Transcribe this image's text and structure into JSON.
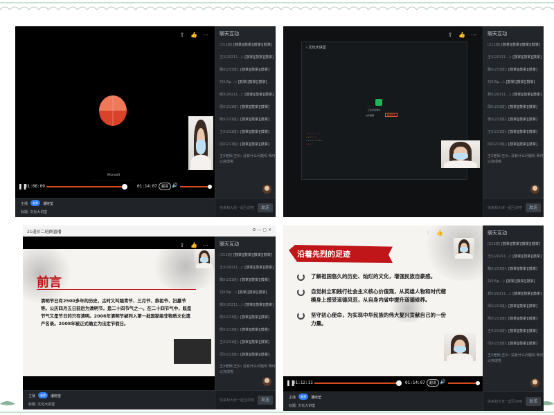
{
  "chat": {
    "title": "聊天互动",
    "placeholder": "快来和大家一起互动吧",
    "send_label": "发送",
    "messages": [
      {
        "who": "(211班)",
        "msg": "[鼓掌][鼓掌][鼓掌][鼓掌]"
      },
      {
        "who": "王X(20211...):",
        "msg": "[鼓掌][鼓掌][鼓掌]"
      },
      {
        "who": "魏X(231班):",
        "msg": "[鼓掌][鼓掌][鼓掌]"
      },
      {
        "who": "刘X(Sp...):",
        "msg": "[鼓掌][鼓掌][鼓掌]"
      },
      {
        "who": "郝X(20211...):",
        "msg": "[鼓掌][鼓掌][鼓掌]"
      },
      {
        "who": "周X(211班):",
        "msg": "[鼓掌][鼓掌][鼓掌]"
      },
      {
        "who": "杨X(211班):",
        "msg": "[鼓掌][鼓掌][鼓掌]"
      },
      {
        "who": "王X(211班):",
        "msg": "[鼓掌][鼓掌][鼓掌]"
      },
      {
        "who": "闫X(211班):",
        "msg": "[鼓掌][鼓掌][鼓掌]"
      }
    ],
    "last_message": "王X老师(王X):  没有什么问题吗 辉可以完成啦"
  },
  "info": {
    "host_label": "主播",
    "host_badge": "老师",
    "host_name": "潘晓莹",
    "title_label": "标题",
    "title_value": "文化大讲堂"
  },
  "panel1": {
    "time_current": "01:06:09",
    "time_total": "01:14:07",
    "quality": "超清",
    "progress": 0.88,
    "caption": "Microsoft"
  },
  "panel2": {
    "window_title": "文化大讲堂",
    "loading_text": "正在加载课件...",
    "share_label": "共享屏幕",
    "stop_label": "结束共享"
  },
  "panel3": {
    "window_title": "21道价二班群直播",
    "slide_heading": "前言",
    "slide_body": "清明节已有2500多年的历史，古时又叫踏青节、三月节、祭祖节、扫墓节等。公历四月五日前后为清明节，是二十四节气之一。在二十四节气中，既是节气又是节日的只有清明。2006年清明节被列入第一批国家级非物质文化遗产名录。2008年被正式确立为法定节假日。"
  },
  "panel4": {
    "time_current": "01:12:11",
    "time_total": "01:14:07",
    "quality": "超清",
    "progress": 0.97,
    "slide_title": "沿着先烈的足迹",
    "bullets": [
      "了解祖国悠久的历史、灿烂的文化，增强民族自豪感。",
      "自觉树立和践行社会主义核心价值观，从英雄人物和时代楷模身上感受道德风范，从自身内省中提升道德修养。",
      "坚守初心使命，为实现中华民族的伟大复兴贡献自己的一份力量。"
    ]
  },
  "colors": {
    "accent": "#d84b1e",
    "pie_top": "#ef7a5b",
    "pie_bottom": "#d9432a",
    "banner_red": "#c0161a",
    "border_green": "#8cc9a3"
  }
}
